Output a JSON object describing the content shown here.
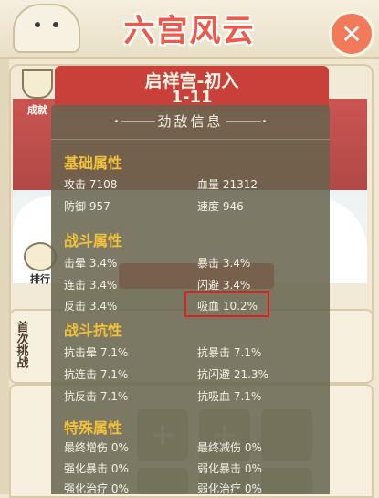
{
  "header": {
    "game_title": "六宫风云",
    "close_icon": "close-x"
  },
  "stage": {
    "name": "启祥宫-初入",
    "number": "1-11",
    "achievement_label": "成就",
    "rank_label": "排行"
  },
  "side_panel": {
    "first_clear_label": "首次挑战"
  },
  "enemy_info": {
    "title": "劲敌信息",
    "sections": {
      "base": {
        "title": "基础属性",
        "stats": [
          {
            "label": "攻击",
            "value": "7108"
          },
          {
            "label": "血量",
            "value": "21312"
          },
          {
            "label": "防御",
            "value": "957"
          },
          {
            "label": "速度",
            "value": "946"
          }
        ]
      },
      "combat": {
        "title": "战斗属性",
        "stats": [
          {
            "label": "击晕",
            "value": "3.4%"
          },
          {
            "label": "暴击",
            "value": "3.4%"
          },
          {
            "label": "连击",
            "value": "3.4%"
          },
          {
            "label": "闪避",
            "value": "3.4%"
          },
          {
            "label": "反击",
            "value": "3.4%"
          },
          {
            "label": "吸血",
            "value": "10.2%"
          }
        ]
      },
      "resist": {
        "title": "战斗抗性",
        "stats": [
          {
            "label": "抗击晕",
            "value": "7.1%"
          },
          {
            "label": "抗暴击",
            "value": "7.1%"
          },
          {
            "label": "抗连击",
            "value": "7.1%"
          },
          {
            "label": "抗闪避",
            "value": "21.3%"
          },
          {
            "label": "抗反击",
            "value": "7.1%"
          },
          {
            "label": "抗吸血",
            "value": "7.1%"
          }
        ]
      },
      "special": {
        "title": "特殊属性",
        "stats": [
          {
            "label": "最终增伤",
            "value": "0%"
          },
          {
            "label": "最终减伤",
            "value": "0%"
          },
          {
            "label": "强化暴击",
            "value": "0%"
          },
          {
            "label": "弱化暴击",
            "value": "0%"
          },
          {
            "label": "强化治疗",
            "value": "0%"
          },
          {
            "label": "弱化治疗",
            "value": "0%"
          }
        ]
      }
    }
  },
  "colors": {
    "title_red": "#f0584a",
    "section_gold": "#f2c23b",
    "highlight_red": "#e21f1f",
    "overlay_bg": "#67644e"
  }
}
